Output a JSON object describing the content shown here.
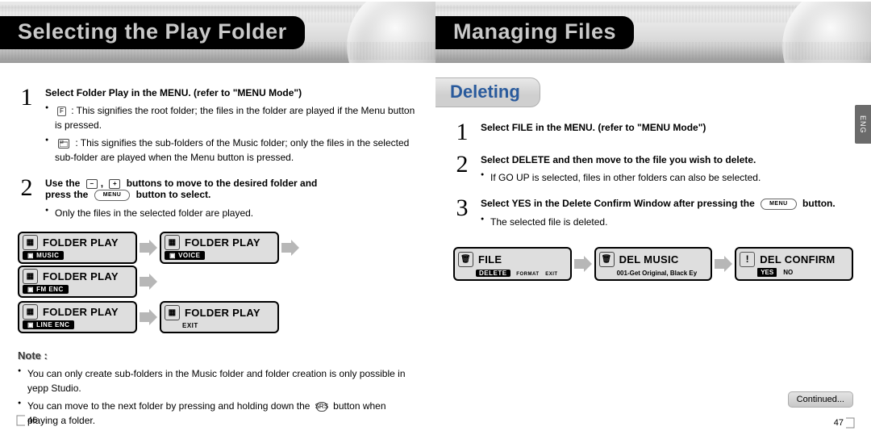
{
  "left": {
    "title": "Selecting the Play Folder",
    "step1": {
      "head": "Select Folder Play in the MENU. (refer to \"MENU Mode\")",
      "li1_icon": "F",
      "li1": ": This signifies the root folder; the files in the folder are played if the Menu button is pressed.",
      "li2": ": This signifies the sub-folders of the Music folder; only the files in the selected sub-folder are played when the Menu button is pressed."
    },
    "step2": {
      "head_a": "Use the ",
      "head_b": " buttons to move to the desired folder and",
      "head2_a": "press the ",
      "head2_btn": "MENU",
      "head2_b": " button to select.",
      "li1": "Only the files in the selected folder are played."
    },
    "panels": [
      {
        "title": "FOLDER PLAY",
        "tag": "MUSIC",
        "tagInPill": true
      },
      {
        "title": "FOLDER PLAY",
        "tag": "VOICE",
        "tagInPill": true
      },
      {
        "title": "FOLDER PLAY",
        "tag": "FM ENC",
        "tagInPill": true
      },
      {
        "title": "FOLDER PLAY",
        "tag": "LINE ENC",
        "tagInPill": true
      },
      {
        "title": "FOLDER PLAY",
        "tag": "EXIT",
        "tagInPill": false
      }
    ],
    "noteTitle": "Note :",
    "note1": "You can only create sub-folders in the Music folder and folder creation is only possible in yepp Studio.",
    "note2": "You can move to the next folder by pressing and holding down the ",
    "note2b": " button when playing a folder.",
    "srsLabel": "SRS",
    "pageNum": "46"
  },
  "right": {
    "title": "Managing Files",
    "eng": "ENG",
    "subTitle": "Deleting",
    "step1": {
      "head": "Select FILE in the MENU. (refer to \"MENU Mode\")"
    },
    "step2": {
      "head": "Select DELETE and then move to the file you wish to delete.",
      "li1": "If GO UP is selected, files in other folders can also be selected."
    },
    "step3": {
      "head_a": "Select YES in the Delete Confirm Window after pressing the ",
      "menu": "MENU",
      "head_b": " button.",
      "li1": "The selected file is deleted."
    },
    "rpanels": {
      "file": {
        "title": "FILE",
        "tag1": "DELETE",
        "tag2": "FORMAT",
        "tag3": "EXIT"
      },
      "del": {
        "title": "DEL MUSIC",
        "line2": "001-Get Original, Black Ey"
      },
      "conf": {
        "title": "DEL CONFIRM",
        "yes": "YES",
        "no": "NO"
      }
    },
    "continued": "Continued...",
    "pageNum": "47"
  }
}
